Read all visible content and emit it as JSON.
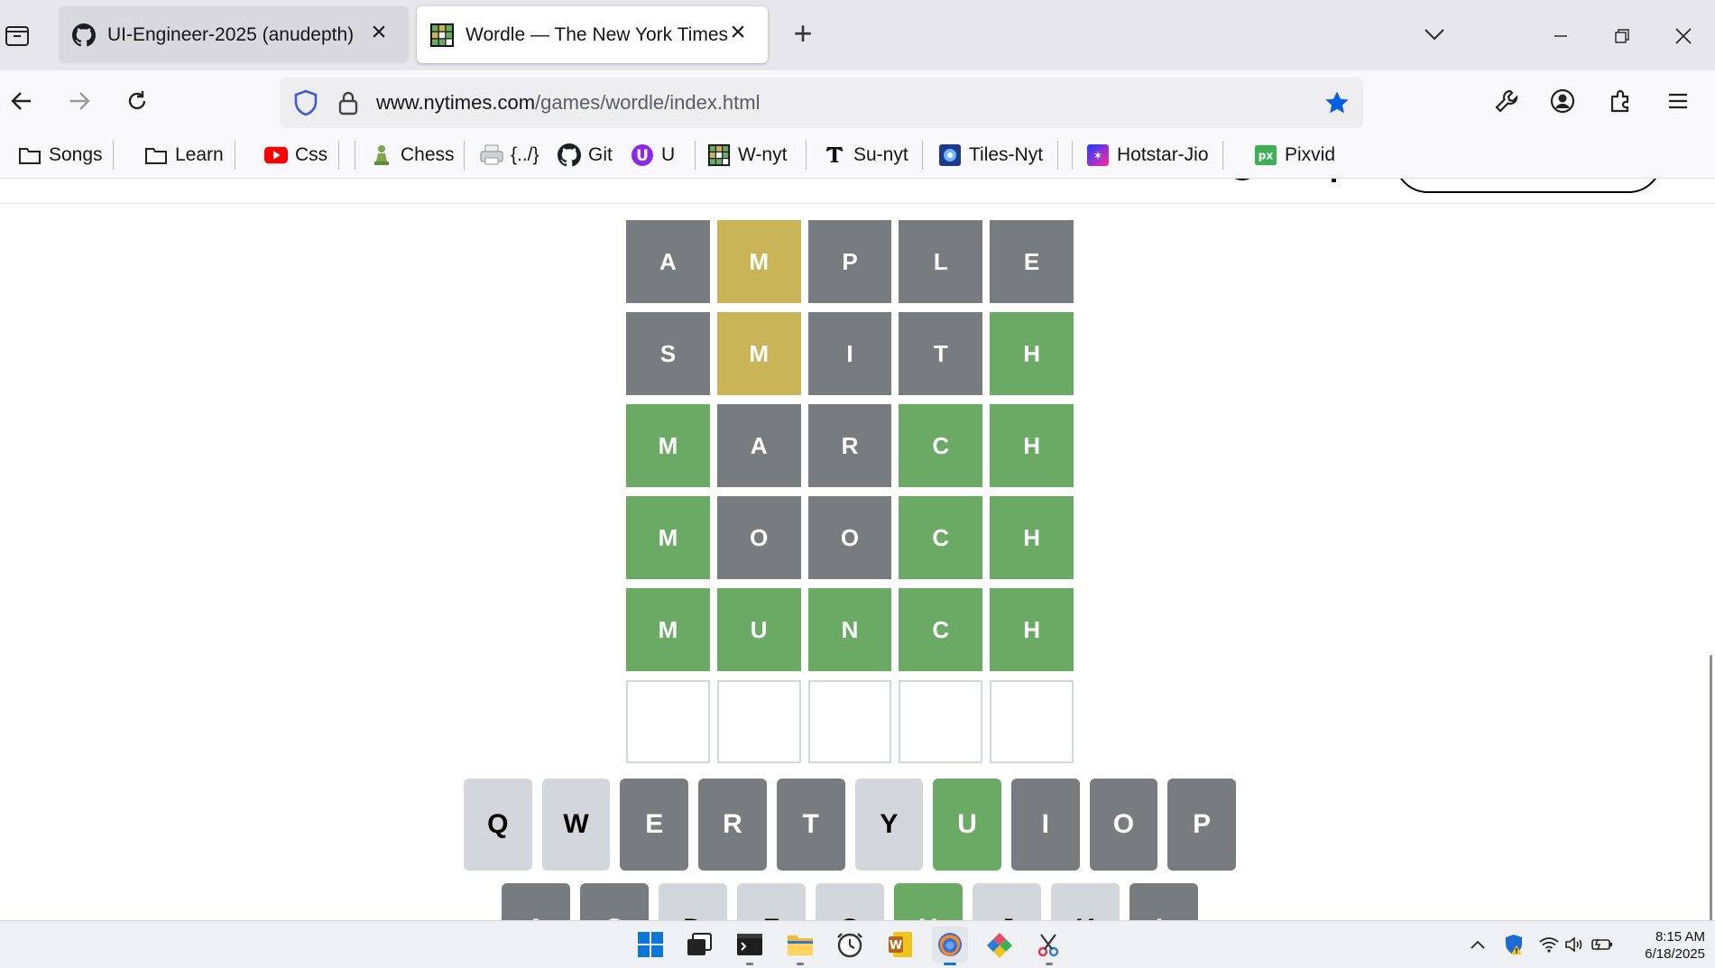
{
  "browser": {
    "tabs": [
      {
        "title": "UI-Engineer-2025 (anudepth)",
        "icon": "github-icon",
        "active": false
      },
      {
        "title": "Wordle — The New York Times",
        "icon": "wordle-grid-icon",
        "active": true
      }
    ],
    "url": {
      "host": "www.nytimes.com",
      "path": "/games/wordle/index.html"
    },
    "bookmarked": true,
    "accent_color": "#0060df"
  },
  "bookmarks": [
    {
      "label": "Songs",
      "icon": "folder-icon"
    },
    {
      "label": "Learn",
      "icon": "folder-icon"
    },
    {
      "label": "Css",
      "icon": "youtube-icon"
    },
    {
      "label": "Chess",
      "icon": "chess-pawn-icon"
    },
    {
      "label": "{../}",
      "icon": "printer-icon"
    },
    {
      "label": "Git",
      "icon": "github-icon"
    },
    {
      "label": "U",
      "icon": "u-badge-icon"
    },
    {
      "label": "W-nyt",
      "icon": "wordle-grid-icon"
    },
    {
      "label": "Su-nyt",
      "icon": "nyt-logo-icon"
    },
    {
      "label": "Tiles-Nyt",
      "icon": "tiles-icon"
    },
    {
      "label": "Hotstar-Jio",
      "icon": "hotstar-icon"
    },
    {
      "label": "Pixvid",
      "icon": "pixvid-icon"
    }
  ],
  "wordle": {
    "colors": {
      "correct": "#6aaa64",
      "present": "#c9b458",
      "absent": "#787c7e",
      "unused": "#d3d6da",
      "empty_border": "#d3d6da"
    },
    "board": [
      [
        {
          "l": "A",
          "s": "absent"
        },
        {
          "l": "M",
          "s": "present"
        },
        {
          "l": "P",
          "s": "absent"
        },
        {
          "l": "L",
          "s": "absent"
        },
        {
          "l": "E",
          "s": "absent"
        }
      ],
      [
        {
          "l": "S",
          "s": "absent"
        },
        {
          "l": "M",
          "s": "present"
        },
        {
          "l": "I",
          "s": "absent"
        },
        {
          "l": "T",
          "s": "absent"
        },
        {
          "l": "H",
          "s": "correct"
        }
      ],
      [
        {
          "l": "M",
          "s": "correct"
        },
        {
          "l": "A",
          "s": "absent"
        },
        {
          "l": "R",
          "s": "absent"
        },
        {
          "l": "C",
          "s": "correct"
        },
        {
          "l": "H",
          "s": "correct"
        }
      ],
      [
        {
          "l": "M",
          "s": "correct"
        },
        {
          "l": "O",
          "s": "absent"
        },
        {
          "l": "O",
          "s": "absent"
        },
        {
          "l": "C",
          "s": "correct"
        },
        {
          "l": "H",
          "s": "correct"
        }
      ],
      [
        {
          "l": "M",
          "s": "correct"
        },
        {
          "l": "U",
          "s": "correct"
        },
        {
          "l": "N",
          "s": "correct"
        },
        {
          "l": "C",
          "s": "correct"
        },
        {
          "l": "H",
          "s": "correct"
        }
      ],
      [
        {
          "l": "",
          "s": "empty"
        },
        {
          "l": "",
          "s": "empty"
        },
        {
          "l": "",
          "s": "empty"
        },
        {
          "l": "",
          "s": "empty"
        },
        {
          "l": "",
          "s": "empty"
        }
      ]
    ],
    "keyboard": [
      [
        {
          "k": "Q",
          "s": "unused"
        },
        {
          "k": "W",
          "s": "unused"
        },
        {
          "k": "E",
          "s": "absent"
        },
        {
          "k": "R",
          "s": "absent"
        },
        {
          "k": "T",
          "s": "absent"
        },
        {
          "k": "Y",
          "s": "unused"
        },
        {
          "k": "U",
          "s": "correct"
        },
        {
          "k": "I",
          "s": "absent"
        },
        {
          "k": "O",
          "s": "absent"
        },
        {
          "k": "P",
          "s": "absent"
        }
      ],
      [
        {
          "k": "A",
          "s": "absent"
        },
        {
          "k": "S",
          "s": "absent"
        },
        {
          "k": "D",
          "s": "unused"
        },
        {
          "k": "F",
          "s": "unused"
        },
        {
          "k": "G",
          "s": "unused"
        },
        {
          "k": "H",
          "s": "correct"
        },
        {
          "k": "J",
          "s": "unused"
        },
        {
          "k": "K",
          "s": "unused"
        },
        {
          "k": "L",
          "s": "absent"
        }
      ]
    ]
  },
  "taskbar": {
    "apps": [
      "start-icon",
      "task-view-icon",
      "terminal-icon",
      "file-explorer-icon",
      "clock-app-icon",
      "word-icon",
      "firefox-icon",
      "color-app-icon",
      "snipping-tool-icon"
    ],
    "tray": {
      "time": "8:15 AM",
      "date": "6/18/2025"
    }
  }
}
